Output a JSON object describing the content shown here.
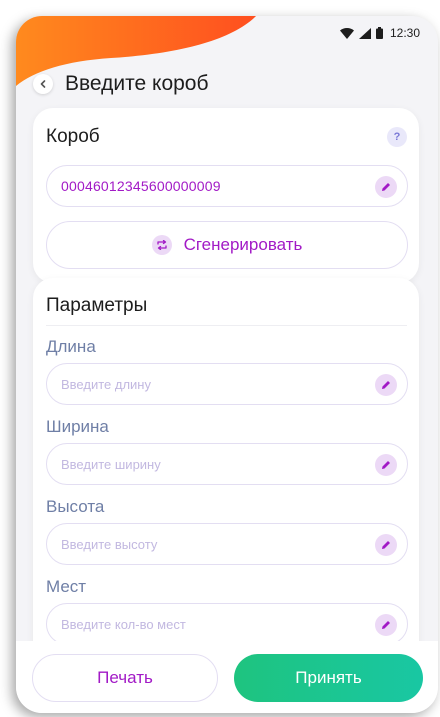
{
  "status_bar": {
    "time": "12:30"
  },
  "header": {
    "title": "Введите короб"
  },
  "box_card": {
    "title": "Короб",
    "help_glyph": "?",
    "box_code": "00046012345600000009",
    "generate_label": "Сгенерировать"
  },
  "params_card": {
    "title": "Параметры",
    "fields": [
      {
        "label": "Длина",
        "placeholder": "Введите длину"
      },
      {
        "label": "Ширина",
        "placeholder": "Введите ширину"
      },
      {
        "label": "Высота",
        "placeholder": "Введите высоту"
      },
      {
        "label": "Мест",
        "placeholder": "Введите кол-во мест"
      }
    ]
  },
  "footer": {
    "print_label": "Печать",
    "accept_label": "Принять"
  },
  "colors": {
    "accent_purple": "#a21ac6",
    "accept_green": "#1ec47f",
    "brand_orange": "#ff6a1f",
    "label_gray_blue": "#6f7fa6"
  },
  "icons": [
    "back-chevron-icon",
    "wifi-icon",
    "signal-icon",
    "battery-icon",
    "help-icon",
    "pencil-icon",
    "refresh-icon"
  ]
}
